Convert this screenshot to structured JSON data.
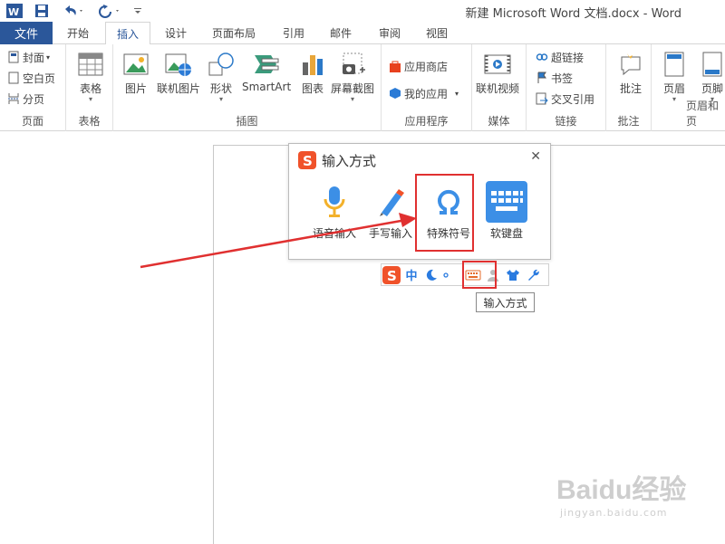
{
  "window": {
    "title": "新建 Microsoft Word 文档.docx - Word"
  },
  "tabs": {
    "file": "文件",
    "items": [
      "开始",
      "插入",
      "设计",
      "页面布局",
      "引用",
      "邮件",
      "审阅",
      "视图"
    ],
    "active": "插入"
  },
  "ribbon": {
    "pages": {
      "label": "页面",
      "cover": "封面",
      "blank": "空白页",
      "break": "分页"
    },
    "tables": {
      "label": "表格",
      "table": "表格"
    },
    "illustrations": {
      "label": "插图",
      "picture": "图片",
      "online_picture": "联机图片",
      "shapes": "形状",
      "smartart": "SmartArt",
      "chart": "图表",
      "screenshot": "屏幕截图"
    },
    "apps": {
      "label": "应用程序",
      "store": "应用商店",
      "my_apps": "我的应用"
    },
    "media": {
      "label": "媒体",
      "online_video": "联机视频"
    },
    "links": {
      "label": "链接",
      "hyperlink": "超链接",
      "bookmark": "书签",
      "cross_ref": "交叉引用"
    },
    "comments": {
      "label": "批注",
      "comment": "批注"
    },
    "header_footer": {
      "label": "页眉和页",
      "header": "页眉",
      "footer": "页脚"
    }
  },
  "ime_popup": {
    "title": "输入方式",
    "items": [
      {
        "label": "语音输入",
        "icon": "microphone-icon"
      },
      {
        "label": "手写输入",
        "icon": "pencil-icon"
      },
      {
        "label": "特殊符号",
        "icon": "omega-icon"
      },
      {
        "label": "软键盘",
        "icon": "keyboard-icon"
      }
    ]
  },
  "ime_bar": {
    "lang": "中",
    "tooltip": "输入方式"
  },
  "watermark": {
    "brand": "Baidu经验",
    "url": "jingyan.baidu.com"
  },
  "colors": {
    "accent": "#2b579a",
    "highlight": "#e03030",
    "sogou": "#f0522a",
    "ime_blue": "#3c8fe6"
  }
}
